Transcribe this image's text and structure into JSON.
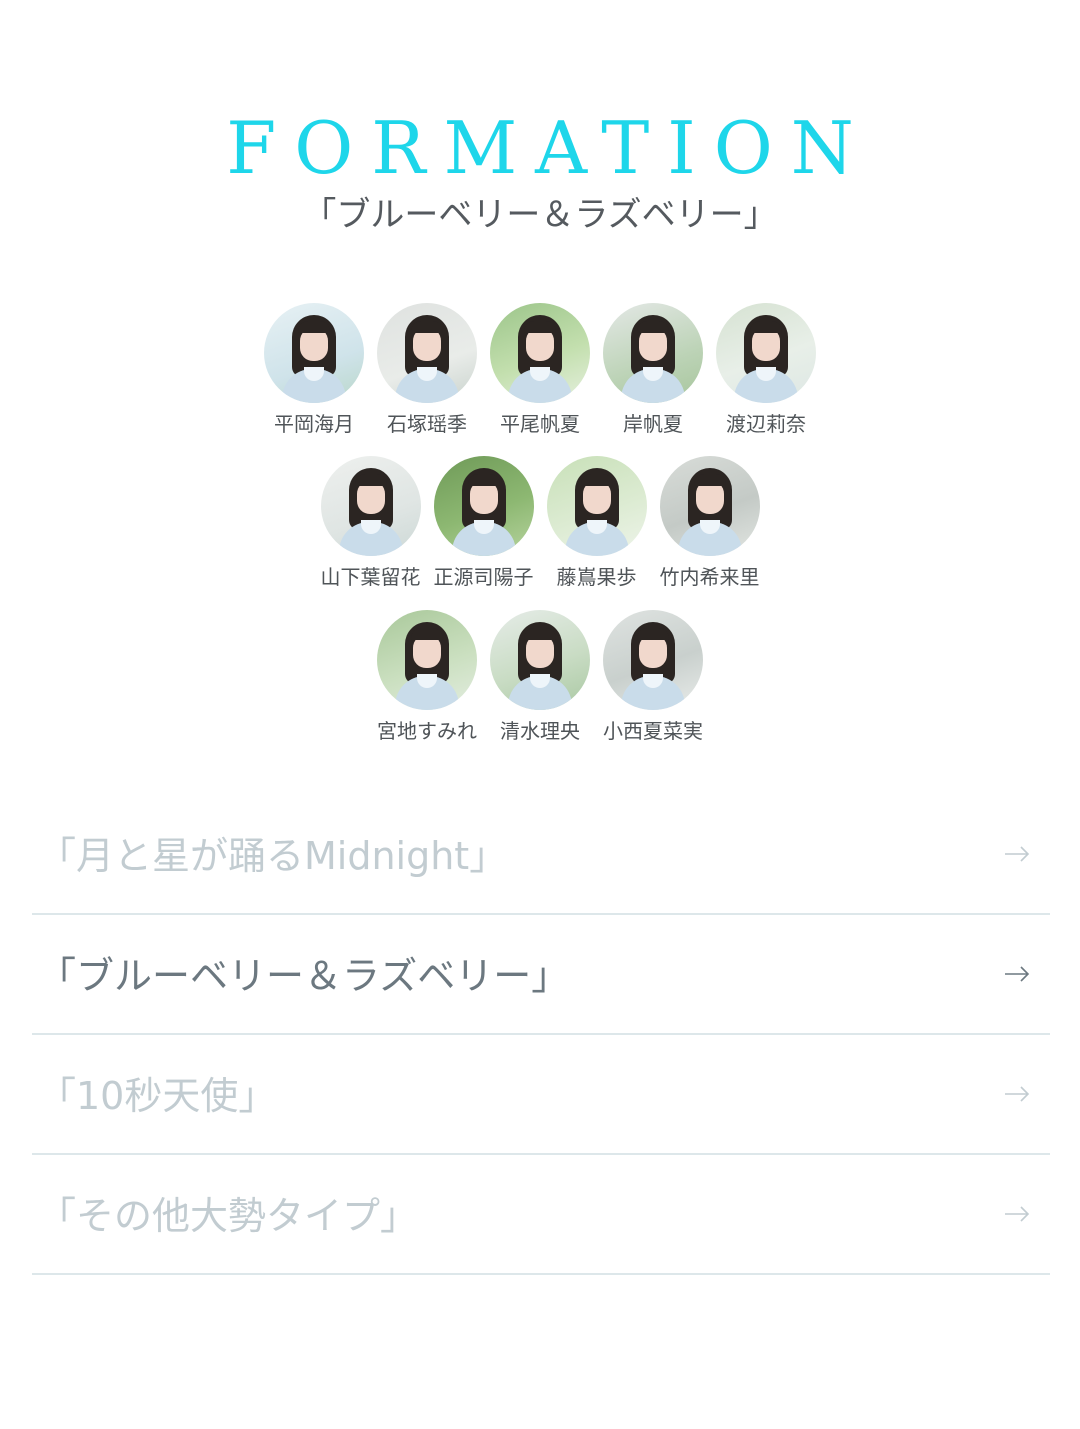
{
  "header": {
    "title": "FORMATION"
  },
  "formation": {
    "song_title": "「ブルーベリー＆ラズベリー」",
    "rows": [
      {
        "members": [
          {
            "name": "平岡海月"
          },
          {
            "name": "石塚瑶季"
          },
          {
            "name": "平尾帆夏"
          },
          {
            "name": "岸帆夏"
          },
          {
            "name": "渡辺莉奈"
          }
        ]
      },
      {
        "members": [
          {
            "name": "山下葉留花"
          },
          {
            "name": "正源司陽子"
          },
          {
            "name": "藤嶌果歩"
          },
          {
            "name": "竹内希来里"
          }
        ]
      },
      {
        "members": [
          {
            "name": "宮地すみれ"
          },
          {
            "name": "清水理央"
          },
          {
            "name": "小西夏菜実"
          }
        ]
      }
    ]
  },
  "song_list": {
    "items": [
      {
        "label": "「月と星が踊るMidnight」",
        "active": false
      },
      {
        "label": "「ブルーベリー＆ラズベリー」",
        "active": true
      },
      {
        "label": "「10秒天使」",
        "active": false
      },
      {
        "label": "「その他大勢タイプ」",
        "active": false
      }
    ],
    "arrow_icon": "arrow-right-icon"
  },
  "colors": {
    "accent": "#1ed6ea",
    "active_text": "#6c7880",
    "inactive_text": "#c2ccd1",
    "divider": "#dde7ea"
  }
}
